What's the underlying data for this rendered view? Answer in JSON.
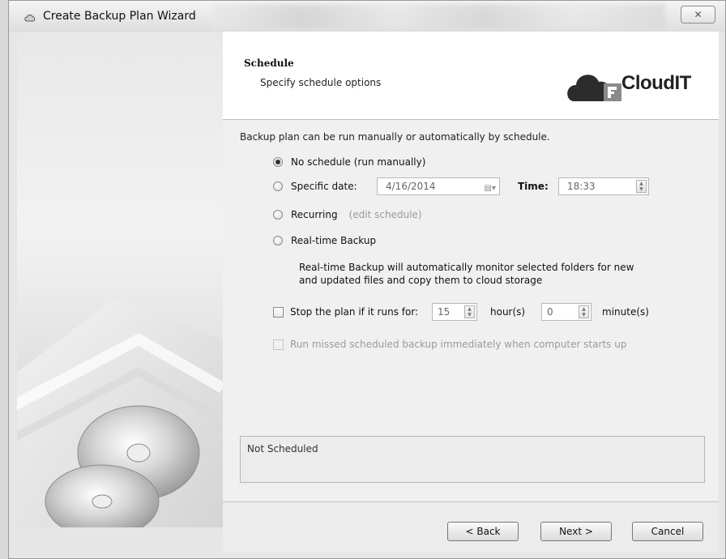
{
  "window": {
    "title": "Create Backup Plan Wizard",
    "close_glyph": "✕"
  },
  "header": {
    "title": "Schedule",
    "subtitle": "Specify schedule options",
    "logo_text": "CloudIT"
  },
  "schedule": {
    "intro": "Backup plan can be run manually or automatically by schedule.",
    "options": {
      "no_schedule": "No schedule (run manually)",
      "specific_date": "Specific date:",
      "recurring": "Recurring",
      "edit_schedule": "(edit schedule)",
      "realtime": "Real-time Backup"
    },
    "selected": "no_schedule",
    "date_value": "4/16/2014",
    "time_label": "Time:",
    "time_value": "18:33",
    "realtime_desc_line1": "Real-time Backup will automatically monitor selected folders for new",
    "realtime_desc_line2": "and updated files and copy them to cloud storage",
    "stop_plan_label": "Stop the plan if it runs for:",
    "stop_hours_value": "15",
    "hours_label": "hour(s)",
    "stop_minutes_value": "0",
    "minutes_label": "minute(s)",
    "run_missed_label": "Run missed scheduled backup immediately when computer starts up"
  },
  "status": {
    "text": "Not Scheduled"
  },
  "footer": {
    "back_label": "< Back",
    "next_label": "Next >",
    "cancel_label": "Cancel"
  },
  "colors": {
    "logo_cloud": "#2c2c2c",
    "logo_accent": "#8a8a8a"
  }
}
